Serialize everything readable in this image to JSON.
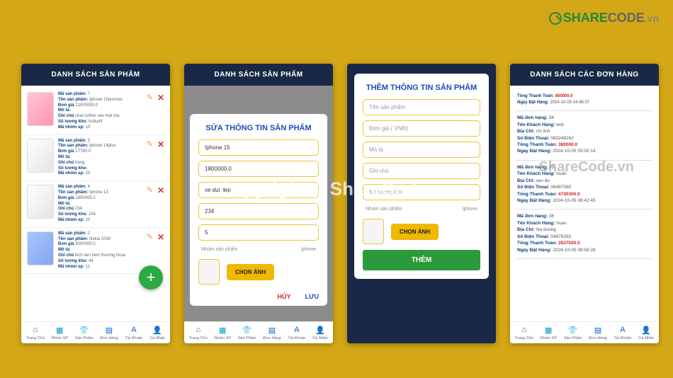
{
  "logo": {
    "s": "SHARE",
    "c": "CODE",
    "v": ".vn"
  },
  "watermark": "Copyright © ShareCode.vn",
  "watermark2": "ShareCode.vn",
  "nav": {
    "home": "Trang Chủ",
    "group": "Nhóm SP",
    "product": "Sản Phẩm",
    "order": "Đơn Hàng",
    "account": "Tài Khoản",
    "personal": "Cá Nhân"
  },
  "labels": {
    "ma": "Mã sản phẩm:",
    "ten": "Tên sản phẩm:",
    "gia": "Đơn giá",
    "mota": "Mô tả:",
    "ghichu": "Ghi chú",
    "kho": "Số lượng kho:",
    "nhom": "Mã nhóm sp:",
    "nhomsp": "Nhóm sản phẩm",
    "iphone": "Iphone",
    "chon": "CHỌN ẢNH"
  },
  "s1": {
    "title": "DANH SÁCH  SẢN PHẨM",
    "products": [
      {
        "id": "7",
        "name": "Iphone 15promax",
        "price": "21000000.0",
        "desc": "",
        "note": "chat coften vào mat ma",
        "kho": "hotkahf",
        "grp": "10",
        "img": "pink"
      },
      {
        "id": "3",
        "name": "Iphone 14plus",
        "price": "17780.0",
        "desc": "",
        "note": "hàng",
        "kho": "",
        "grp": "10",
        "img": "white"
      },
      {
        "id": "4",
        "name": "Iphone 13",
        "price": "1600005.0",
        "desc": "",
        "note": "234",
        "kho": "234",
        "grp": "10",
        "img": "white"
      },
      {
        "id": "2",
        "name": "Nokia 2000",
        "price": "3000000.0",
        "desc": "",
        "note": "kich lam tiem thương thoại",
        "kho": "44",
        "grp": "11",
        "img": "blue"
      }
    ]
  },
  "s2": {
    "title": "DANH SÁCH  SẢN PHẨM",
    "mtitle": "SỬA THÔNG TIN SẢN PHẨM",
    "f": {
      "name": "Iphone 15",
      "price": "1800000.0",
      "desc": "xe dui dep",
      "kho": "234",
      "grp": "5"
    },
    "cancel": "HỦY",
    "save": "LƯU"
  },
  "s3": {
    "mtitle": "THÊM THÔNG TIN SẢN PHẨM",
    "ph": {
      "name": "Tên sản phẩm",
      "price": "Đơn giá ( VNĐ)",
      "desc": "Mô tả",
      "note": "Ghi chú",
      "kho": "Số lượng kho"
    },
    "add": "THÊM"
  },
  "s4": {
    "title": "DANH SÁCH CÁC ĐƠN HÀNG",
    "lbl": {
      "madh": "Mã đơn hàng:",
      "tkh": "Tên Khách Hàng:",
      "dc": "Địa Chỉ:",
      "sdt": "Số Điện Thoại:",
      "tt": "Tổng Thanh Toán:",
      "ndh": "Ngày Đặt Hàng:"
    },
    "orders": [
      {
        "total": "850000.0",
        "date": "2024-10-05 04:48:37"
      },
      {
        "id": "34",
        "name": "test",
        "addr": "chi linh",
        "phone": "083248262",
        "total": "380000.0",
        "date": "2024-10-05 05:00:14"
      },
      {
        "id": "35",
        "name": "huan",
        "addr": "seo do",
        "phone": "06487365",
        "total": "4730300.0",
        "date": "2024-10-05 08:42:45"
      },
      {
        "id": "36",
        "name": "huan",
        "addr": "hia duong",
        "phone": "04678265",
        "total": "2637020.0",
        "date": "2024-10-05 08:58:28"
      }
    ]
  }
}
